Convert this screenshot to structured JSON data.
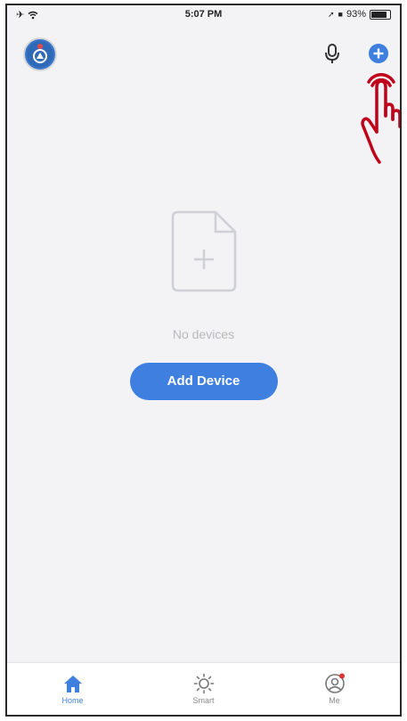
{
  "status_bar": {
    "time": "5:07 PM",
    "battery_label": "93%",
    "battery_level": 0.93
  },
  "header": {
    "avatar_icon": "user-avatar",
    "mic_icon": "microphone-icon",
    "add_icon": "plus-circle-icon"
  },
  "empty_state": {
    "icon": "document-plus-icon",
    "message": "No devices",
    "button_label": "Add Device"
  },
  "tabs": [
    {
      "label": "Home",
      "icon": "home-icon",
      "active": true
    },
    {
      "label": "Smart",
      "icon": "sun-icon",
      "active": false
    },
    {
      "label": "Me",
      "icon": "user-circle-icon",
      "active": false
    }
  ],
  "colors": {
    "accent": "#3f7fe0",
    "background": "#f3f3f5",
    "pointer_hand": "#c0001a"
  }
}
